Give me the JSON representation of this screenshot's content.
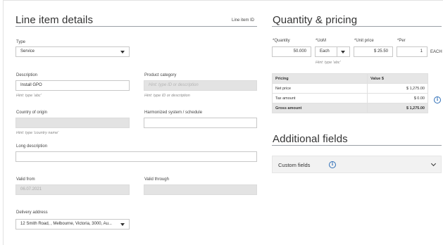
{
  "line_item": {
    "title": "Line item details",
    "id_label": "Line item ID",
    "type": {
      "label": "Type",
      "value": "Service"
    },
    "description": {
      "label": "Description",
      "value": "Install GPO",
      "hint": "Hint: type 'abc'"
    },
    "product_category": {
      "label": "Product category",
      "placeholder": "Hint: type ID or description",
      "hint": "Hint: type ID or description"
    },
    "country": {
      "label": "Country of origin",
      "value": "",
      "hint": "Hint: type 'country name'"
    },
    "hs": {
      "label": "Harmonized system / schedule",
      "value": ""
    },
    "long_description": {
      "label": "Long description",
      "value": ""
    },
    "valid_from": {
      "label": "Valid from",
      "value": "06.07.2021"
    },
    "valid_through": {
      "label": "Valid through",
      "value": ""
    },
    "delivery": {
      "label": "Delivery address",
      "value": "12 Smith Road, , Melbourne, Victoria, 3000, Au..."
    }
  },
  "pricing": {
    "title": "Quantity & pricing",
    "quantity": {
      "label": "*Quantity",
      "value": "50.000"
    },
    "uom": {
      "label": "*UoM",
      "value": "Each",
      "hint": "Hint: type 'abc'"
    },
    "unit_price": {
      "label": "*Unit price",
      "value": "$ 25.50"
    },
    "per": {
      "label": "*Per",
      "value": "1",
      "unit": "EACH"
    },
    "table": {
      "col1": "Pricing",
      "col2": "Value $",
      "rows": [
        {
          "label": "Net price",
          "value": "$ 1,275.00"
        },
        {
          "label": "Tax amount",
          "value": "$ 0.00"
        }
      ],
      "total": {
        "label": "Gross amount",
        "value": "$ 1,275.00"
      }
    }
  },
  "additional": {
    "title": "Additional fields",
    "custom_fields_label": "Custom fields"
  }
}
